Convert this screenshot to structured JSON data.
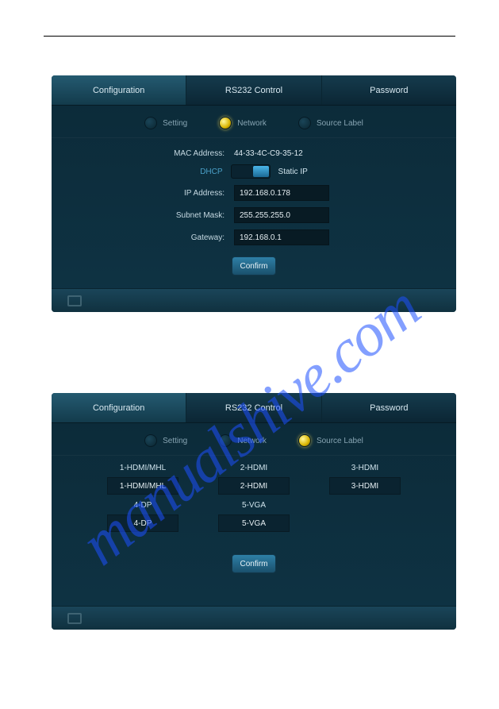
{
  "watermark": "manualshive.com",
  "tabs": {
    "configuration": "Configuration",
    "rs232": "RS232 Control",
    "password": "Password"
  },
  "subtabs": {
    "setting": "Setting",
    "network": "Network",
    "source_label": "Source Label"
  },
  "network": {
    "mac_label": "MAC Address:",
    "mac_value": "44-33-4C-C9-35-12",
    "dhcp_label": "DHCP",
    "staticip_label": "Static IP",
    "ip_label": "IP Address:",
    "ip_value": "192.168.0.178",
    "subnet_label": "Subnet Mask:",
    "subnet_value": "255.255.255.0",
    "gateway_label": "Gateway:",
    "gateway_value": "192.168.0.1",
    "confirm": "Confirm"
  },
  "sources": {
    "items": [
      {
        "label": "1-HDMI/MHL",
        "value": "1-HDMI/MHL"
      },
      {
        "label": "2-HDMI",
        "value": "2-HDMI"
      },
      {
        "label": "3-HDMI",
        "value": "3-HDMI"
      },
      {
        "label": "4-DP",
        "value": "4-DP"
      },
      {
        "label": "5-VGA",
        "value": "5-VGA"
      }
    ],
    "confirm": "Confirm"
  }
}
